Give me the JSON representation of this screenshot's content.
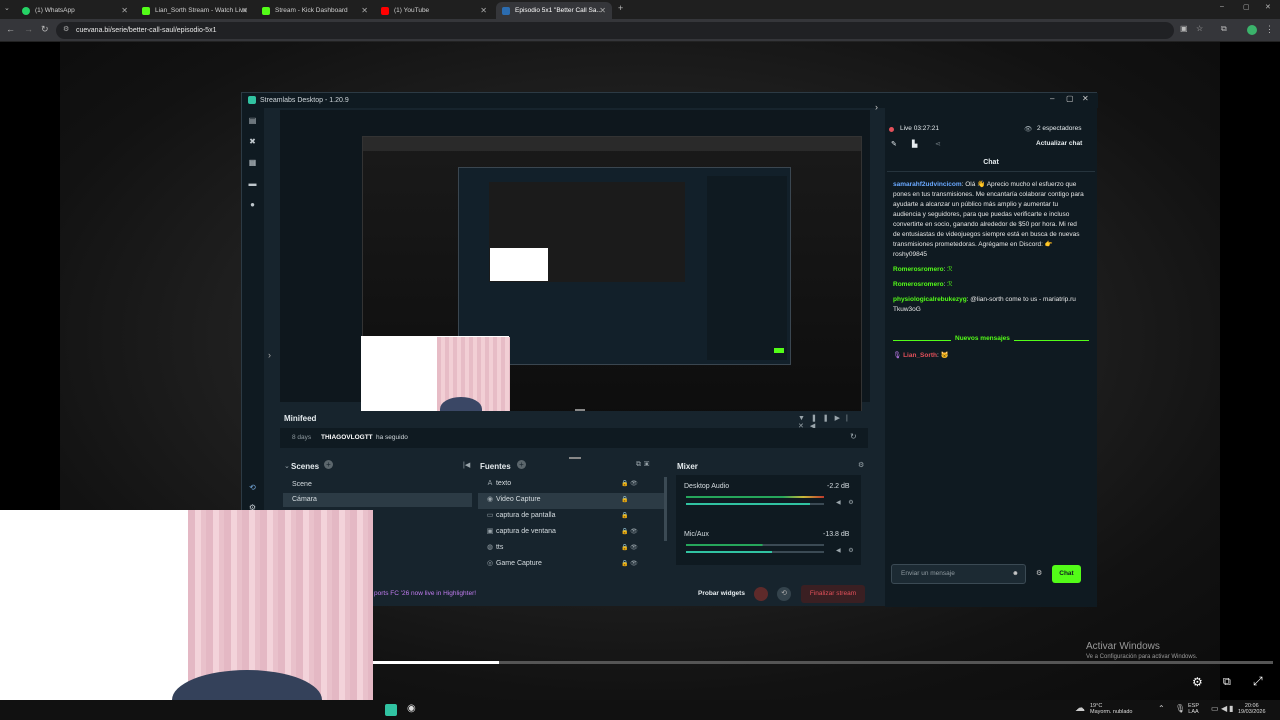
{
  "browser": {
    "tabs": [
      {
        "label": "(1) WhatsApp",
        "color": "#25d366"
      },
      {
        "label": "Lian_Sorth Stream - Watch Live",
        "color": "#53fc18"
      },
      {
        "label": "Stream - Kick Dashboard",
        "color": "#53fc18"
      },
      {
        "label": "(1) YouTube",
        "color": "#ff0000"
      },
      {
        "label": "Episodio 5x1 \"Better Call Sa...",
        "color": "#2b6cb0"
      }
    ],
    "url": "cuevana.bi/serie/better-call-saul/episodio-5x1"
  },
  "streamlabs": {
    "title": "Streamlabs Desktop - 1.20.9",
    "minifeed": {
      "title": "Minifeed",
      "event_time": "8 days",
      "event_user": "THIAGOVLOGTT",
      "event_action": "ha seguido"
    },
    "scenes": {
      "title": "Scenes",
      "items": [
        "Scene",
        "Cámara"
      ]
    },
    "sources": {
      "title": "Fuentes",
      "items": [
        "texto",
        "Video Capture",
        "captura de pantalla",
        "captura de ventana",
        "tts",
        "Game Capture"
      ]
    },
    "mixer": {
      "title": "Mixer",
      "channels": [
        {
          "name": "Desktop Audio",
          "db": "-2.2 dB",
          "level": 0.9
        },
        {
          "name": "Mic/Aux",
          "db": "-13.8 dB",
          "level": 0.62
        }
      ]
    },
    "footer": {
      "promo": "ports FC '26 now live in Highlighter!",
      "test_widgets": "Probar widgets",
      "end_stream": "Finalizar stream"
    },
    "chat_panel": {
      "live": "Live 03:27:21",
      "viewers": "2 espectadores",
      "refresh": "Actualizar chat",
      "title": "Chat",
      "messages": [
        {
          "user": "samarahf2udvincicom",
          "text": ": Olá 👋 Aprecio mucho el esfuerzo que pones en tus transmisiones. Me encantaría colaborar contigo para ayudarte a alcanzar un público más amplio y aumentar tu audiencia y seguidores, para que puedas verificarte e incluso convertirte en socio, ganando alrededor de $50 por hora. Mi red de entusiastas de videojuegos siempre está en busca de nuevas transmisiones prometedoras. Agrégame en Discord: 👉 roshy09845"
        },
        {
          "user": "Romerosromero",
          "text": ":"
        },
        {
          "user": "Romerosromero",
          "text": ":"
        },
        {
          "user": "physiologicalrebukezyg",
          "text": ": @lian-sorth come to us - mariatrip.ru Tkuw3oG"
        }
      ],
      "new_messages": "Nuevos mensajes",
      "last_user": "Lian_Sorth",
      "input_placeholder": "Enviar un mensaje",
      "send": "Chat"
    }
  },
  "watermark": {
    "title": "Activar Windows",
    "subtitle": "Ve a Configuración para activar Windows."
  },
  "taskbar": {
    "weather": "19°C",
    "weather_desc": "Mayorm. nublado",
    "lang1": "ESP",
    "lang2": "LAA",
    "time": "20:06",
    "date": "19/03/2026"
  }
}
